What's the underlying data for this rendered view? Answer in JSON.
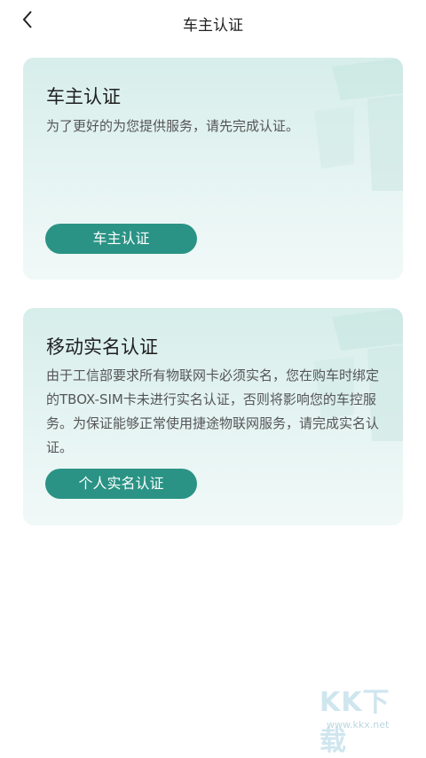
{
  "nav": {
    "title": "车主认证",
    "back_icon": "chevron-left-icon"
  },
  "owner_card": {
    "title": "车主认证",
    "description": "为了更好的为您提供服务，请先完成认证。",
    "button_label": "车主认证"
  },
  "realname_card": {
    "title": "移动实名认证",
    "description": "由于工信部要求所有物联网卡必须实名，您在购车时绑定的TBOX-SIM卡未进行实名认证，否则将影响您的车控服务。为保证能够正常使用捷途物联网服务，请完成实名认证。",
    "button_label": "个人实名认证"
  },
  "watermark": {
    "main": "KK下载",
    "sub": "www.kkx.net"
  },
  "colors": {
    "accent": "#2a9385",
    "card_bg": "#d7eeeb"
  }
}
